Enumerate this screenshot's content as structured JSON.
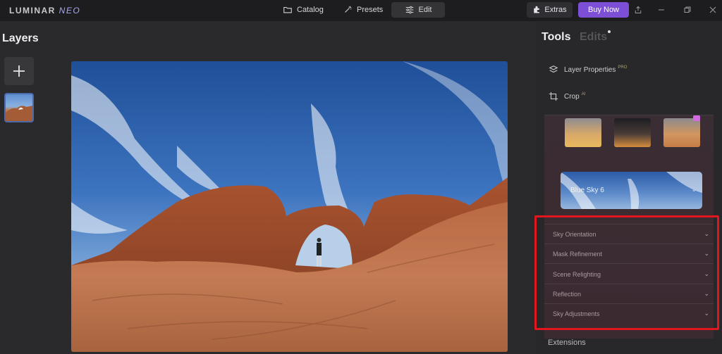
{
  "app": {
    "logo": "LUMINAR",
    "logo_neo": "NEO"
  },
  "topbar": {
    "catalog_label": "Catalog",
    "presets_label": "Presets",
    "edit_label": "Edit",
    "extras_label": "Extras",
    "buy_now_label": "Buy Now",
    "buy_now_color": "#7d4fd6"
  },
  "left_panel": {
    "title": "Layers",
    "add_icon": "plus-icon"
  },
  "right_panel": {
    "tabs": [
      {
        "label": "Tools",
        "active": true
      },
      {
        "label": "Edits",
        "active": false
      }
    ],
    "tools": [
      {
        "label": "Layer Properties",
        "badge": "PRO",
        "icon": "layers-icon"
      },
      {
        "label": "Crop",
        "badge": "AI",
        "icon": "crop-icon"
      }
    ],
    "sky_selection": "Blue Sky 6",
    "sections": [
      {
        "label": "Sky Orientation"
      },
      {
        "label": "Mask Refinement"
      },
      {
        "label": "Scene Relighting"
      },
      {
        "label": "Reflection"
      },
      {
        "label": "Sky Adjustments"
      }
    ],
    "extensions_label": "Extensions",
    "highlight_color": "#e2161f"
  }
}
